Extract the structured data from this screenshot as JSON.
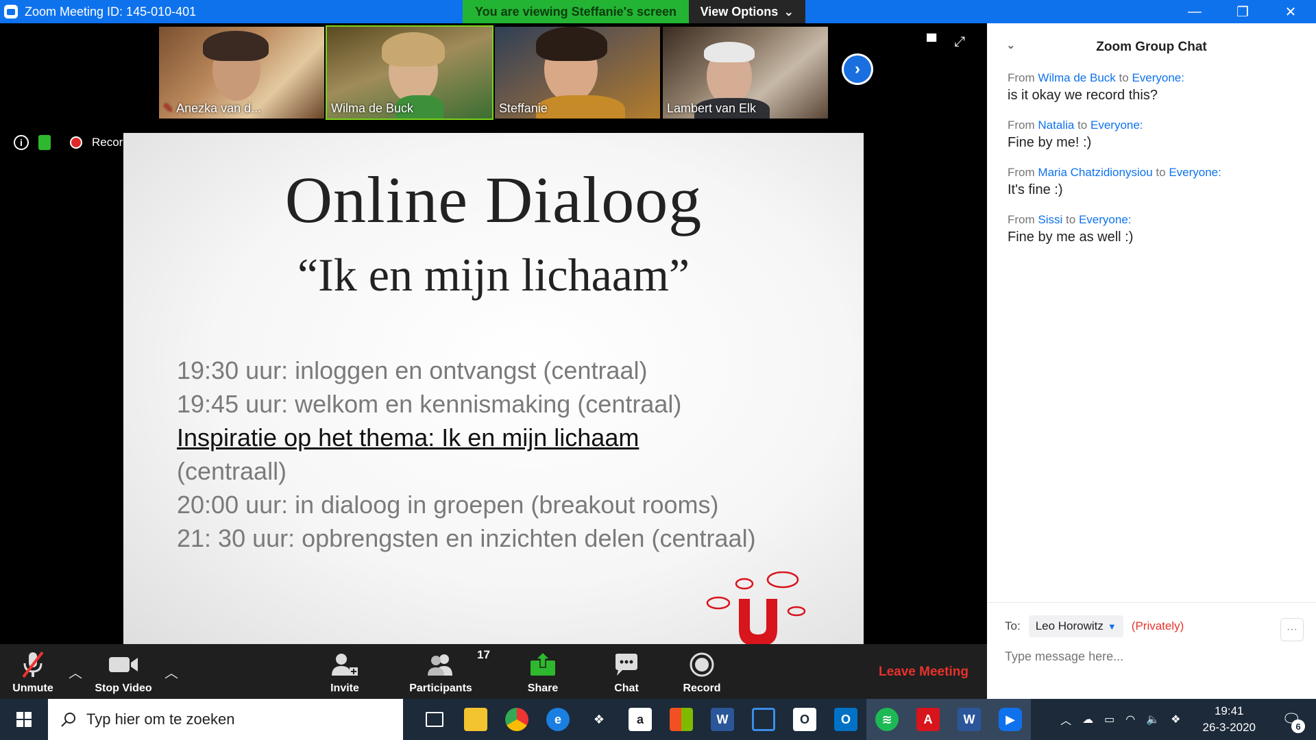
{
  "window": {
    "title": "Zoom Meeting ID: 145-010-401",
    "viewing_banner": "You are viewing Steffanie's screen",
    "view_options": "View Options"
  },
  "participants": [
    {
      "name": "Anezka van d..."
    },
    {
      "name": "Wilma de Buck"
    },
    {
      "name": "Steffanie"
    },
    {
      "name": "Lambert van Elk"
    }
  ],
  "status": {
    "recording": "Recording"
  },
  "slide": {
    "title": "Online Dialoog",
    "subtitle": "“Ik en mijn lichaam”",
    "agenda": [
      "19:30 uur: inloggen en ontvangst (centraal)",
      "19:45 uur: welkom en kennismaking (centraal)",
      "Inspiratie op het thema:  Ik en mijn lichaam",
      "(centraall)",
      "20:00 uur: in dialoog in groepen (breakout rooms)",
      "21: 30 uur: opbrengsten en inzichten delen (centraal)"
    ]
  },
  "toolbar": {
    "unmute": "Unmute",
    "stop_video": "Stop Video",
    "invite": "Invite",
    "participants": "Participants",
    "participants_count": "17",
    "share": "Share",
    "chat": "Chat",
    "record": "Record",
    "leave": "Leave Meeting"
  },
  "chat": {
    "title": "Zoom Group Chat",
    "from_word": "From",
    "to_word": "to",
    "messages": [
      {
        "from": "Wilma de Buck",
        "to": "Everyone:",
        "text": "is it okay we record this?"
      },
      {
        "from": "Natalia",
        "to": "Everyone:",
        "text": "Fine by me! :)"
      },
      {
        "from": "Maria Chatzidionysiou",
        "to": "Everyone:",
        "text": "It's fine :)"
      },
      {
        "from": "Sissi",
        "to": "Everyone:",
        "text": "Fine by me as well :)"
      }
    ],
    "to_label": "To:",
    "recipient": "Leo Horowitz",
    "privately": "(Privately)",
    "placeholder": "Type message here..."
  },
  "taskbar": {
    "search_placeholder": "Typ hier om te zoeken",
    "time": "19:41",
    "date": "26-3-2020",
    "notifications": "6"
  },
  "colors": {
    "zoom_blue": "#0e72ed",
    "banner_green": "#23b434",
    "leave_red": "#e8322b"
  }
}
